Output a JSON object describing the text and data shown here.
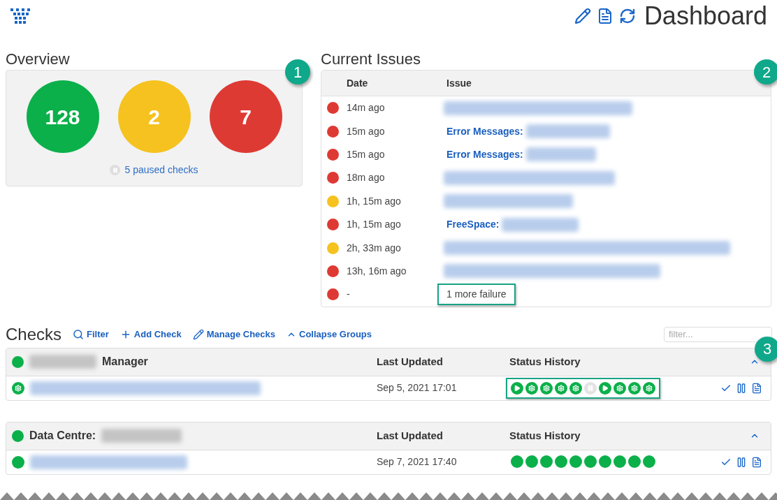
{
  "header": {
    "title": "Dashboard"
  },
  "overview": {
    "title": "Overview",
    "badge": "1",
    "paused": "5 paused checks",
    "counts": [
      {
        "value": "128",
        "color": "#0bb04a"
      },
      {
        "value": "2",
        "color": "#f5c21f"
      },
      {
        "value": "7",
        "color": "#de3a34"
      }
    ]
  },
  "issues": {
    "title": "Current Issues",
    "badge": "2",
    "columns": [
      "Date",
      "Issue"
    ],
    "rows": [
      {
        "date": "14m ago",
        "color": "#de3a34",
        "kind": "blurred"
      },
      {
        "date": "15m ago",
        "color": "#de3a34",
        "kind": "labelled",
        "label": "Error Messages:"
      },
      {
        "date": "15m ago",
        "color": "#de3a34",
        "kind": "labelled",
        "label": "Error Messages:"
      },
      {
        "date": "18m ago",
        "color": "#de3a34",
        "kind": "blurred"
      },
      {
        "date": "1h, 15m ago",
        "color": "#f5c21f",
        "kind": "blurred"
      },
      {
        "date": "1h, 15m ago",
        "color": "#de3a34",
        "kind": "labelled",
        "label": "FreeSpace:"
      },
      {
        "date": "2h, 33m ago",
        "color": "#f5c21f",
        "kind": "blurred"
      },
      {
        "date": "13h, 16m ago",
        "color": "#de3a34",
        "kind": "blurred"
      },
      {
        "date": "-",
        "color": "#de3a34",
        "kind": "more",
        "text": "1 more failure",
        "highlighted": true
      }
    ]
  },
  "checks": {
    "title": "Checks",
    "badge": "3",
    "filter_placeholder": "filter...",
    "actions": [
      {
        "kind": "search",
        "label": "Filter"
      },
      {
        "kind": "plus",
        "label": "Add Check"
      },
      {
        "kind": "pencil",
        "label": "Manage Checks"
      },
      {
        "kind": "collapse",
        "label": "Collapse Groups"
      }
    ],
    "groups": [
      {
        "kind": "suffix",
        "name": "Manager",
        "color": "#0bb04a",
        "columns": [
          "Last Updated",
          "Status History"
        ],
        "rows": [
          {
            "kind": "gear",
            "updated": "Sep 5, 2021 17:01",
            "highlighted": true,
            "history": [
              {
                "kind": "play"
              },
              {
                "kind": "gear"
              },
              {
                "kind": "gear"
              },
              {
                "kind": "gear"
              },
              {
                "kind": "gear"
              },
              {
                "kind": "paused"
              },
              {
                "kind": "play"
              },
              {
                "kind": "gear"
              },
              {
                "kind": "gear"
              },
              {
                "kind": "gear"
              }
            ]
          }
        ]
      },
      {
        "kind": "prefix",
        "name": "Data Centre:",
        "color": "#0bb04a",
        "columns": [
          "Last Updated",
          "Status History"
        ],
        "rows": [
          {
            "kind": "dot",
            "updated": "Sep 7, 2021 17:40",
            "highlighted": false,
            "history": [
              {
                "kind": "dot"
              },
              {
                "kind": "dot"
              },
              {
                "kind": "dot"
              },
              {
                "kind": "dot"
              },
              {
                "kind": "dot"
              },
              {
                "kind": "dot"
              },
              {
                "kind": "dot"
              },
              {
                "kind": "dot"
              },
              {
                "kind": "dot"
              },
              {
                "kind": "dot"
              }
            ]
          }
        ]
      }
    ]
  }
}
